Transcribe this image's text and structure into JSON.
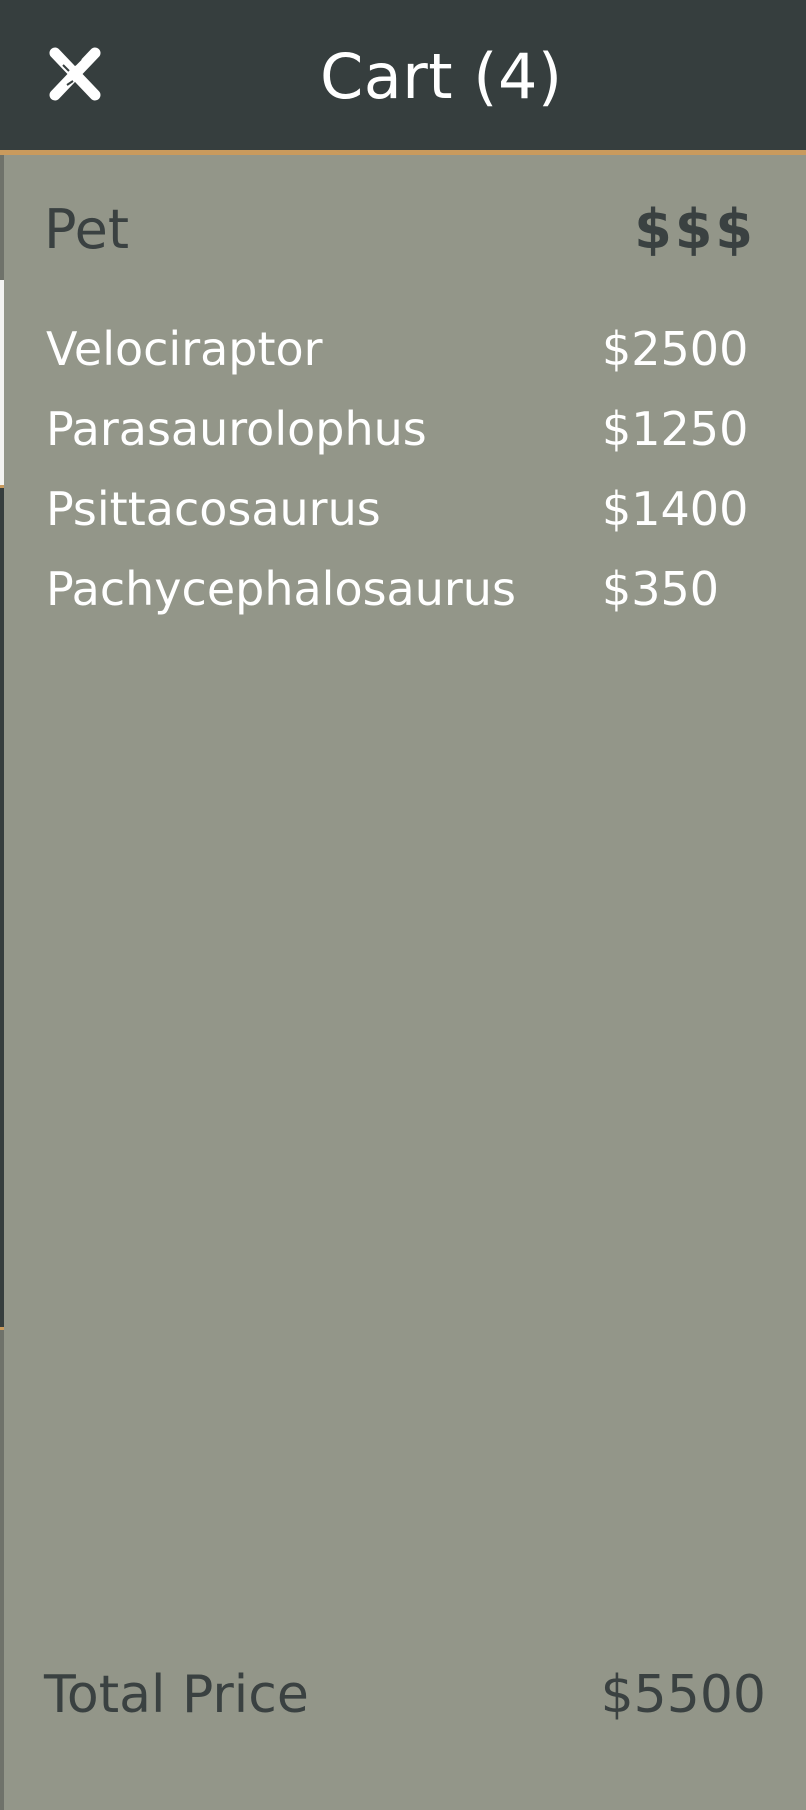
{
  "header": {
    "title": "Cart (4)",
    "close_icon": "close-icon"
  },
  "table": {
    "col_pet": "Pet",
    "col_price": "$$$",
    "items": [
      {
        "name": "Velociraptor",
        "price": "$2500"
      },
      {
        "name": "Parasaurolophus",
        "price": "$1250"
      },
      {
        "name": "Psittacosaurus",
        "price": "$1400"
      },
      {
        "name": "Pachycephalosaurus",
        "price": "$350"
      }
    ]
  },
  "summary": {
    "total_label": "Total Price",
    "total_value": "$5500"
  },
  "colors": {
    "header_bg": "#363e3e",
    "panel_bg": "#939689",
    "accent": "#c99a5d",
    "dark_text": "#3a4141",
    "light_text": "#ffffff"
  }
}
